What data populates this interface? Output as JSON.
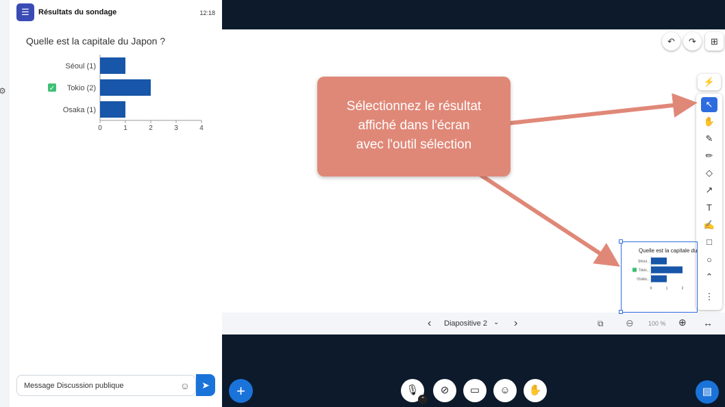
{
  "panel": {
    "title": "Résultats du sondage",
    "time": "12:18",
    "question": "Quelle est la capitale du Japon ?",
    "chat_placeholder": "Message Discussion publique"
  },
  "chart_data": {
    "type": "bar",
    "orientation": "horizontal",
    "categories": [
      "Séoul (1)",
      "Tokio (2)",
      "Osaka (1)"
    ],
    "values": [
      1,
      2,
      1
    ],
    "correct_category": "Tokio (2)",
    "xticks": [
      "0",
      "1",
      "2",
      "3",
      "4"
    ],
    "xlim": [
      0,
      4
    ],
    "bar_color": "#1756a9",
    "grid": false
  },
  "mini_chart": {
    "title": "Quelle est la capitale du",
    "categories": [
      "Séoul...",
      "Tokio...",
      "Osaka..."
    ],
    "values": [
      1,
      2,
      1
    ],
    "xticks": [
      "0",
      "1",
      "2"
    ]
  },
  "callout": {
    "text_lines": [
      "Sélectionnez le résultat",
      "affiché dans l'écran",
      "avec l'outil sélection"
    ],
    "color": "#e08878"
  },
  "slide_nav": {
    "slide_label": "Diapositive 2",
    "zoom": "100 %"
  },
  "colors": {
    "accent": "#1a73d9",
    "dark_bg": "#0c1a2b",
    "tool_active": "#2d6cdf"
  }
}
